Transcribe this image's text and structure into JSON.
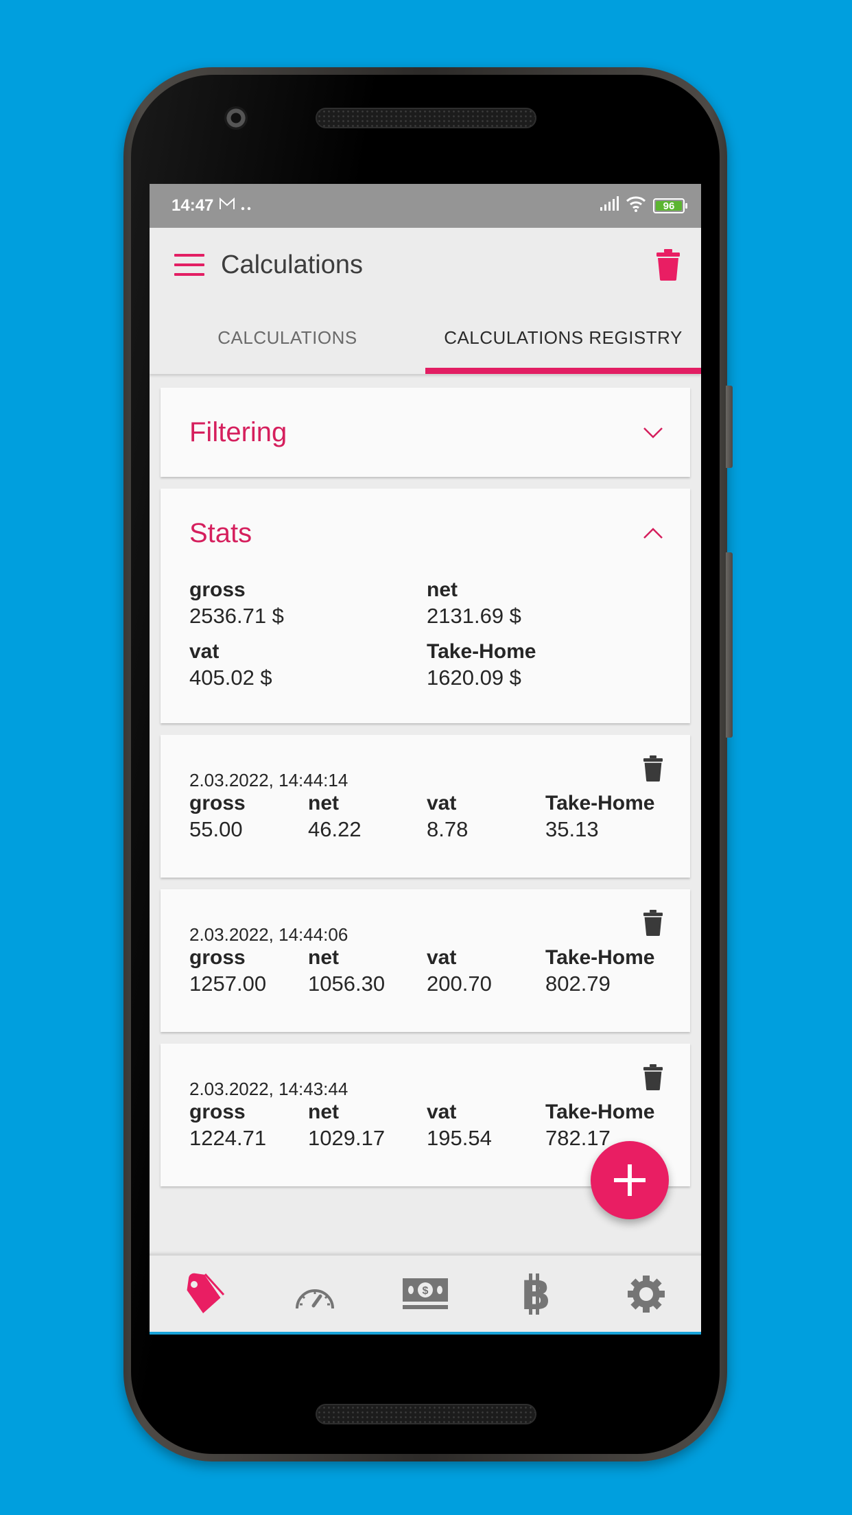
{
  "status_bar": {
    "time": "14:47",
    "notification_icons": [
      "gmail-icon",
      "more-dots-icon"
    ],
    "battery_level": "96"
  },
  "app_bar": {
    "title": "Calculations",
    "menu_icon": "menu-icon",
    "action_icon": "trash-icon"
  },
  "tabs": [
    {
      "label": "CALCULATIONS",
      "active": false
    },
    {
      "label": "CALCULATIONS REGISTRY",
      "active": true
    }
  ],
  "filtering_panel": {
    "title": "Filtering",
    "expanded": false
  },
  "stats_panel": {
    "title": "Stats",
    "expanded": true,
    "items": [
      {
        "label": "gross",
        "value": "2536.71 $"
      },
      {
        "label": "net",
        "value": "2131.69 $"
      },
      {
        "label": "vat",
        "value": "405.02 $"
      },
      {
        "label": "Take-Home",
        "value": "1620.09 $"
      }
    ]
  },
  "records": [
    {
      "datetime": "2.03.2022, 14:44:14",
      "columns": [
        {
          "label": "gross",
          "value": "55.00"
        },
        {
          "label": "net",
          "value": "46.22"
        },
        {
          "label": "vat",
          "value": "8.78"
        },
        {
          "label": "Take-Home",
          "value": "35.13"
        }
      ]
    },
    {
      "datetime": "2.03.2022, 14:44:06",
      "columns": [
        {
          "label": "gross",
          "value": "1257.00"
        },
        {
          "label": "net",
          "value": "1056.30"
        },
        {
          "label": "vat",
          "value": "200.70"
        },
        {
          "label": "Take-Home",
          "value": "802.79"
        }
      ]
    },
    {
      "datetime": "2.03.2022, 14:43:44",
      "columns": [
        {
          "label": "gross",
          "value": "1224.71"
        },
        {
          "label": "net",
          "value": "1029.17"
        },
        {
          "label": "vat",
          "value": "195.54"
        },
        {
          "label": "Take-Home",
          "value": "782.17"
        }
      ]
    }
  ],
  "fab": {
    "icon": "plus-icon"
  },
  "bottom_nav": [
    {
      "icon": "price-tag-icon",
      "active": true
    },
    {
      "icon": "speedometer-icon",
      "active": false
    },
    {
      "icon": "cash-icon",
      "active": false
    },
    {
      "icon": "bitcoin-icon",
      "active": false
    },
    {
      "icon": "gear-icon",
      "active": false
    }
  ],
  "colors": {
    "accent": "#e91e63",
    "title_accent": "#d51f5d",
    "background": "#009fde",
    "status_bar": "#959595",
    "nav_inactive": "#757575"
  }
}
